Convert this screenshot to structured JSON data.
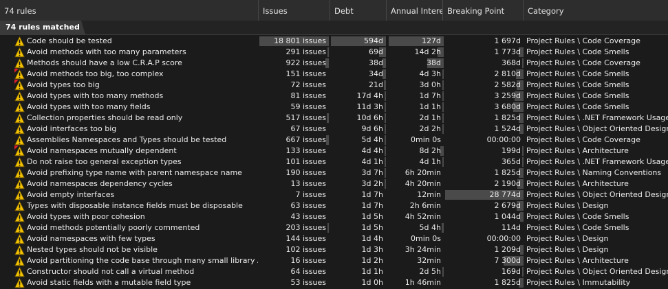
{
  "header": {
    "col_rules": "74 rules",
    "col_issues": "Issues",
    "col_debt": "Debt",
    "col_annual": "Annual Intere",
    "col_breaking": "Breaking Point",
    "col_category": "Category"
  },
  "group_label": "74 rules matched",
  "colors": {
    "background": "#1b1b1b",
    "warning": "#f2c100",
    "critical_mark": "#d8202a",
    "highlight_bar": "#4a4a4a"
  },
  "rows": [
    {
      "name": "Code should be tested",
      "issues": "18 801 issues",
      "debt": "594d",
      "annual": "127d",
      "breaking": "1 697d",
      "category": "Project Rules \\ Code Coverage",
      "critical": false,
      "bars": {
        "issues": 1.0,
        "debt": 1.0,
        "annual": 1.0,
        "breaking": 0
      }
    },
    {
      "name": "Avoid methods with too many parameters",
      "issues": "291 issues",
      "debt": "69d",
      "annual": "14d  2h",
      "breaking": "1 773d",
      "category": "Project Rules \\ Code Smells",
      "critical": false,
      "bars": {
        "issues": 0.02,
        "debt": 0.12,
        "annual": 0.11,
        "breaking": 0.06
      }
    },
    {
      "name": "Methods should have a low C.R.A.P score",
      "issues": "922 issues",
      "debt": "38d",
      "annual": "38d",
      "breaking": "368d",
      "category": "Project Rules \\ Code Coverage",
      "critical": false,
      "bars": {
        "issues": 0.05,
        "debt": 0.06,
        "annual": 0.3,
        "breaking": 0.01
      }
    },
    {
      "name": "Avoid methods too big, too complex",
      "issues": "151 issues",
      "debt": "34d",
      "annual": "4d  3h",
      "breaking": "2 810d",
      "category": "Project Rules \\ Code Smells",
      "critical": true,
      "bars": {
        "issues": 0,
        "debt": 0.06,
        "annual": 0.03,
        "breaking": 0.1
      }
    },
    {
      "name": "Avoid types too big",
      "issues": "72 issues",
      "debt": "21d",
      "annual": "3d  0h",
      "breaking": "2 582d",
      "category": "Project Rules \\ Code Smells",
      "critical": true,
      "bars": {
        "issues": 0,
        "debt": 0.04,
        "annual": 0.02,
        "breaking": 0.09
      }
    },
    {
      "name": "Avoid types with too many methods",
      "issues": "81 issues",
      "debt": "17d  4h",
      "annual": "1d  7h",
      "breaking": "3 259d",
      "category": "Project Rules \\ Code Smells",
      "critical": false,
      "bars": {
        "issues": 0,
        "debt": 0.03,
        "annual": 0.01,
        "breaking": 0.11
      }
    },
    {
      "name": "Avoid types with too many fields",
      "issues": "59 issues",
      "debt": "11d  3h",
      "annual": "1d  1h",
      "breaking": "3 680d",
      "category": "Project Rules \\ Code Smells",
      "critical": false,
      "bars": {
        "issues": 0,
        "debt": 0.02,
        "annual": 0.01,
        "breaking": 0.13
      }
    },
    {
      "name": "Collection properties should be read only",
      "issues": "517 issues",
      "debt": "10d  6h",
      "annual": "2d  1h",
      "breaking": "1 825d",
      "category": "Project Rules \\ .NET Framework Usage \\ ...",
      "critical": false,
      "bars": {
        "issues": 0.03,
        "debt": 0.02,
        "annual": 0.02,
        "breaking": 0.06
      }
    },
    {
      "name": "Avoid interfaces too big",
      "issues": "67 issues",
      "debt": "9d  6h",
      "annual": "2d  2h",
      "breaking": "1 524d",
      "category": "Project Rules \\ Object Oriented Design",
      "critical": false,
      "bars": {
        "issues": 0,
        "debt": 0.02,
        "annual": 0.02,
        "breaking": 0.05
      }
    },
    {
      "name": "Assemblies Namespaces and Types should be tested",
      "issues": "667 issues",
      "debt": "5d  4h",
      "annual": "0min  0s",
      "breaking": "00:00:00",
      "category": "Project Rules \\ Code Coverage",
      "critical": false,
      "bars": {
        "issues": 0.04,
        "debt": 0.01,
        "annual": 0,
        "breaking": 0
      }
    },
    {
      "name": "Avoid namespaces mutually dependent",
      "issues": "133 issues",
      "debt": "4d  4h",
      "annual": "8d  2h",
      "breaking": "199d",
      "category": "Project Rules \\ Architecture",
      "critical": true,
      "bars": {
        "issues": 0,
        "debt": 0.01,
        "annual": 0.06,
        "breaking": 0.01
      }
    },
    {
      "name": "Do not raise too general exception types",
      "issues": "101 issues",
      "debt": "4d  1h",
      "annual": "4d  1h",
      "breaking": "365d",
      "category": "Project Rules \\ .NET Framework Usage \\ ...",
      "critical": false,
      "bars": {
        "issues": 0,
        "debt": 0.01,
        "annual": 0.03,
        "breaking": 0.01
      }
    },
    {
      "name": "Avoid prefixing type name with parent namespace name",
      "issues": "190 issues",
      "debt": "3d  7h",
      "annual": "6h  20min",
      "breaking": "1 825d",
      "category": "Project Rules \\ Naming Conventions",
      "critical": false,
      "bars": {
        "issues": 0,
        "debt": 0.01,
        "annual": 0,
        "breaking": 0.06
      }
    },
    {
      "name": "Avoid namespaces dependency cycles",
      "issues": "13 issues",
      "debt": "3d  2h",
      "annual": "4h  20min",
      "breaking": "2 190d",
      "category": "Project Rules \\ Architecture",
      "critical": false,
      "bars": {
        "issues": 0,
        "debt": 0.01,
        "annual": 0,
        "breaking": 0.08
      }
    },
    {
      "name": "Avoid empty interfaces",
      "issues": "7 issues",
      "debt": "1d  7h",
      "annual": "12min",
      "breaking": "28 774d",
      "category": "Project Rules \\ Object Oriented Design",
      "critical": false,
      "bars": {
        "issues": 0,
        "debt": 0,
        "annual": 0,
        "breaking": 1.0
      }
    },
    {
      "name": "Types with disposable instance fields must be disposable",
      "issues": "63 issues",
      "debt": "1d  7h",
      "annual": "2h  6min",
      "breaking": "2 679d",
      "category": "Project Rules \\ Design",
      "critical": false,
      "bars": {
        "issues": 0,
        "debt": 0,
        "annual": 0,
        "breaking": 0.09
      }
    },
    {
      "name": "Avoid types with poor cohesion",
      "issues": "43 issues",
      "debt": "1d  5h",
      "annual": "4h  52min",
      "breaking": "1 044d",
      "category": "Project Rules \\ Code Smells",
      "critical": false,
      "bars": {
        "issues": 0,
        "debt": 0,
        "annual": 0,
        "breaking": 0.04
      }
    },
    {
      "name": "Avoid methods potentially poorly commented",
      "issues": "203 issues",
      "debt": "1d  5h",
      "annual": "5d  4h",
      "breaking": "114d",
      "category": "Project Rules \\ Code Smells",
      "critical": false,
      "bars": {
        "issues": 0.01,
        "debt": 0,
        "annual": 0.04,
        "breaking": 0
      }
    },
    {
      "name": "Avoid namespaces with few types",
      "issues": "144 issues",
      "debt": "1d  4h",
      "annual": "0min  0s",
      "breaking": "00:00:00",
      "category": "Project Rules \\ Design",
      "critical": false,
      "bars": {
        "issues": 0,
        "debt": 0,
        "annual": 0,
        "breaking": 0
      }
    },
    {
      "name": "Nested types should not be visible",
      "issues": "102 issues",
      "debt": "1d  3h",
      "annual": "3h  24min",
      "breaking": "1 209d",
      "category": "Project Rules \\ Design",
      "critical": false,
      "bars": {
        "issues": 0,
        "debt": 0,
        "annual": 0,
        "breaking": 0.04
      }
    },
    {
      "name": "Avoid partitioning the code base through many small library Assemb",
      "issues": "16 issues",
      "debt": "1d  2h",
      "annual": "32min",
      "breaking": "7 300d",
      "category": "Project Rules \\ Architecture",
      "critical": false,
      "bars": {
        "issues": 0,
        "debt": 0,
        "annual": 0,
        "breaking": 0.25
      }
    },
    {
      "name": "Constructor should not call a virtual method",
      "issues": "64 issues",
      "debt": "1d  1h",
      "annual": "2d  5h",
      "breaking": "169d",
      "category": "Project Rules \\ Object Oriented Design",
      "critical": false,
      "bars": {
        "issues": 0,
        "debt": 0,
        "annual": 0.02,
        "breaking": 0.01
      }
    },
    {
      "name": "Avoid static fields with a mutable field type",
      "issues": "53 issues",
      "debt": "1d  0h",
      "annual": "1h  46min",
      "breaking": "1 825d",
      "category": "Project Rules \\ Immutability",
      "critical": false,
      "bars": {
        "issues": 0,
        "debt": 0,
        "annual": 0,
        "breaking": 0.06
      }
    }
  ]
}
